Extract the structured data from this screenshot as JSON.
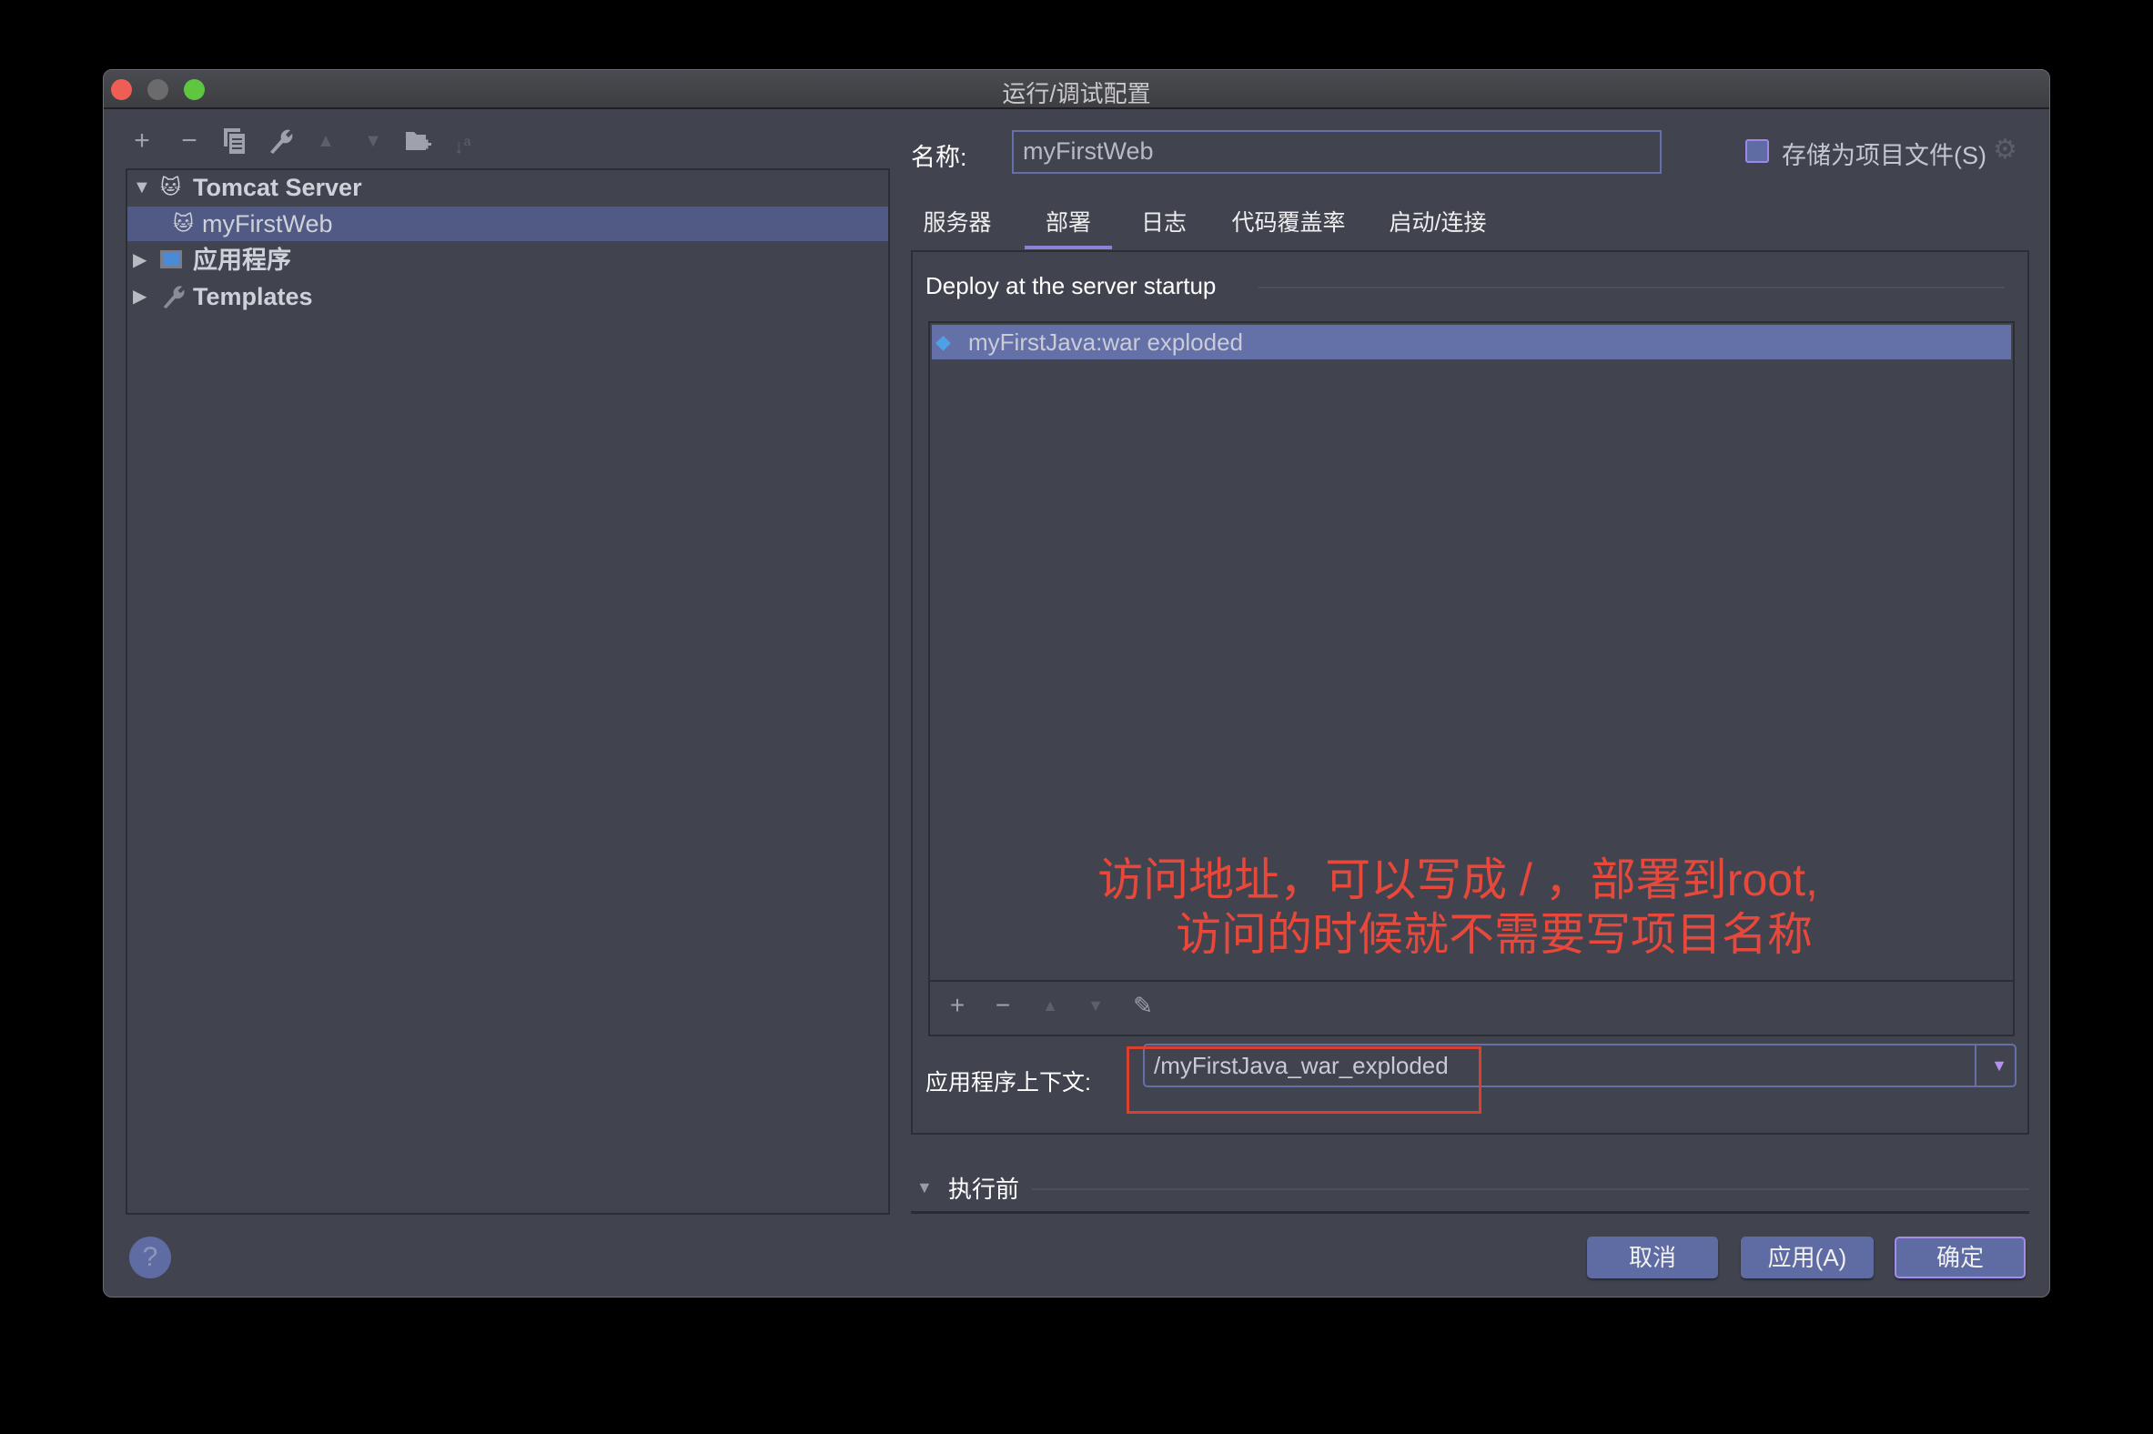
{
  "window": {
    "title": "运行/调试配置",
    "traffic_lights": {
      "close": "#ee5e55",
      "minimize": "#6b6b6e",
      "maximize": "#5fc640"
    }
  },
  "toolbar": {
    "icons": [
      {
        "name": "add-icon",
        "glyph": "+",
        "enabled": true
      },
      {
        "name": "remove-icon",
        "glyph": "−",
        "enabled": true
      },
      {
        "name": "copy-icon",
        "glyph": "⧉",
        "enabled": true
      },
      {
        "name": "wrench-icon",
        "glyph": "🔧",
        "enabled": true
      },
      {
        "name": "move-up-icon",
        "glyph": "▲",
        "enabled": false
      },
      {
        "name": "move-down-icon",
        "glyph": "▼",
        "enabled": false
      },
      {
        "name": "new-folder-icon",
        "glyph": "▰",
        "enabled": true
      },
      {
        "name": "sort-icon",
        "glyph": "↓ᵃ",
        "enabled": false
      }
    ]
  },
  "tree": {
    "items": [
      {
        "label": "Tomcat Server",
        "expanded": true,
        "icon": "tomcat-icon",
        "bold": true
      },
      {
        "label": "myFirstWeb",
        "selected": true,
        "icon": "tomcat-icon"
      },
      {
        "label": "应用程序",
        "expanded": false,
        "icon": "application-icon",
        "bold": true
      },
      {
        "label": "Templates",
        "expanded": false,
        "icon": "wrench-icon",
        "bold": true
      }
    ]
  },
  "name_field": {
    "label": "名称:",
    "value": "myFirstWeb"
  },
  "store_as_project_file": {
    "label": "存储为项目文件(S)",
    "checked": false
  },
  "tabs": [
    {
      "label": "服务器",
      "active": false
    },
    {
      "label": "部署",
      "active": true
    },
    {
      "label": "日志",
      "active": false
    },
    {
      "label": "代码覆盖率",
      "active": false
    },
    {
      "label": "启动/连接",
      "active": false
    }
  ],
  "deploy": {
    "section_title": "Deploy at the server startup",
    "items": [
      {
        "label": "myFirstJava:war exploded",
        "selected": true
      }
    ],
    "list_toolbar": [
      "add-icon",
      "remove-icon",
      "move-up-icon",
      "move-down-icon",
      "edit-icon"
    ]
  },
  "annotation": {
    "line1": "访问地址，可以写成 / ，部署到root,",
    "line2": "访问的时候就不需要写项目名称",
    "color": "#e8483a"
  },
  "context_field": {
    "label": "应用程序上下文:",
    "value": "/myFirstJava_war_exploded"
  },
  "before_launch": {
    "label": "执行前",
    "expanded": true
  },
  "buttons": {
    "cancel": "取消",
    "apply": "应用(A)",
    "ok": "确定",
    "help": "?"
  },
  "colors": {
    "accent": "#5f6ca3",
    "selection": "#505a85",
    "focus": "#a28ee8",
    "background": "#41434f"
  }
}
